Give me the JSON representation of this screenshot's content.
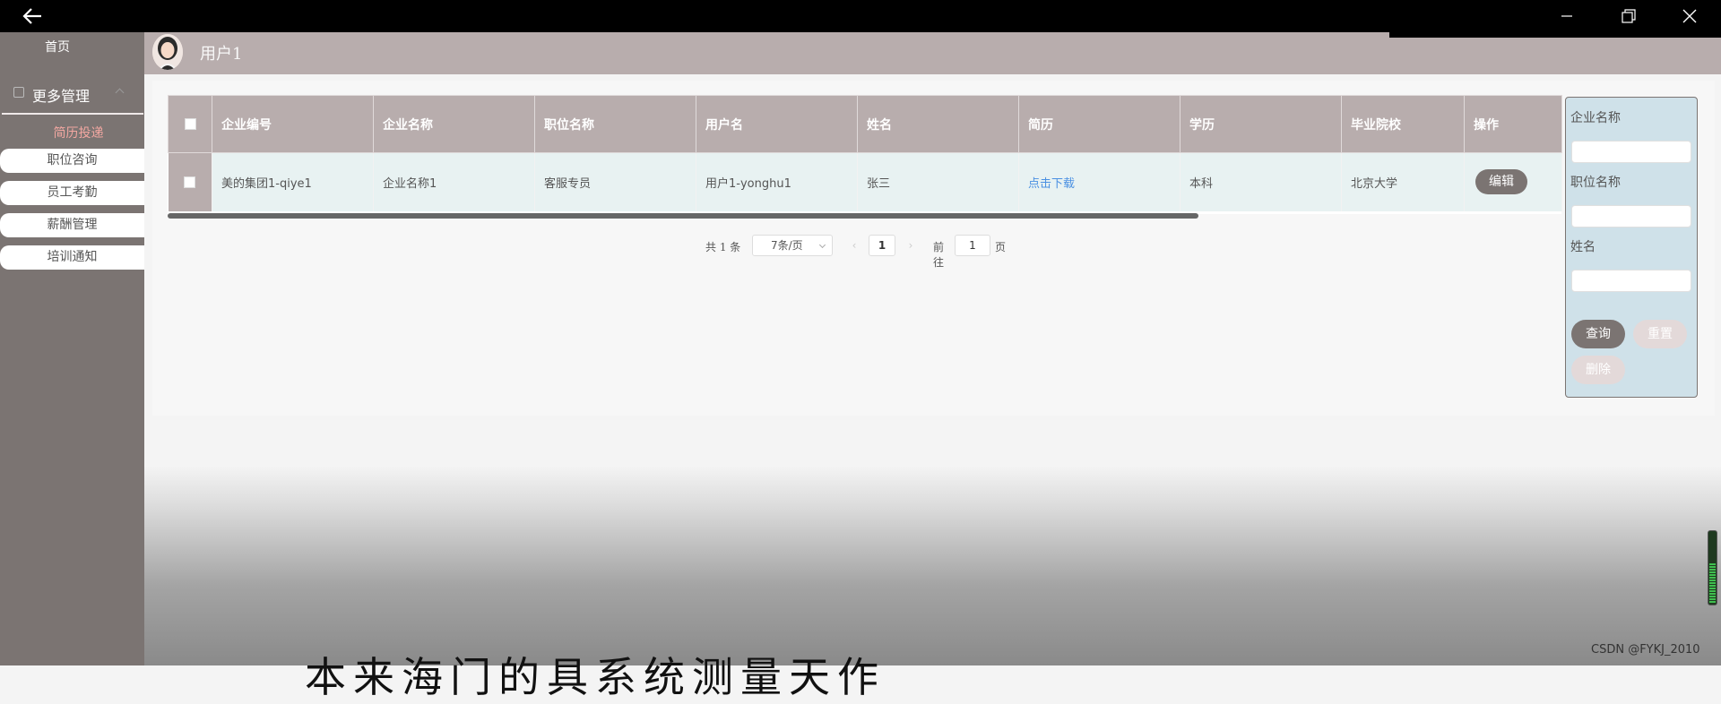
{
  "window": {
    "back_icon": "arrow-left-icon",
    "minimize_icon": "minimize-icon",
    "restore_icon": "restore-icon",
    "close_icon": "close-icon"
  },
  "sidebar": {
    "home": "首页",
    "more_management": "更多管理",
    "active_item": "简历投递",
    "items": [
      {
        "label": "职位咨询"
      },
      {
        "label": "员工考勤"
      },
      {
        "label": "薪酬管理"
      },
      {
        "label": "培训通知"
      }
    ]
  },
  "header": {
    "username": "用户1"
  },
  "table": {
    "columns": [
      "企业编号",
      "企业名称",
      "职位名称",
      "用户名",
      "姓名",
      "简历",
      "学历",
      "毕业院校",
      "操作"
    ],
    "rows": [
      {
        "company_id": "美的集团1-qiye1",
        "company_name": "企业名称1",
        "position": "客服专员",
        "user": "用户1-yonghu1",
        "name": "张三",
        "resume_link": "点击下载",
        "education": "本科",
        "school": "北京大学",
        "action": "编辑"
      }
    ]
  },
  "pager": {
    "total": "共 1 条",
    "page_size": "7条/页",
    "current_page": "1",
    "goto_label": "前往",
    "goto_value": "1",
    "page_unit": "页"
  },
  "search": {
    "company_label": "企业名称",
    "position_label": "职位名称",
    "name_label": "姓名",
    "query": "查询",
    "reset": "重置",
    "delete": "删除"
  },
  "overlay": {
    "caption": "本来海门的具系统测量天作",
    "watermark": "CSDN @FYKJ_2010"
  },
  "colors": {
    "sidebar": "#7b7472",
    "header": "#b8adad",
    "active_text": "#f2a7a1",
    "row_bg": "#e8f2f2",
    "search_panel": "#cfe1e9",
    "link": "#4a90e2"
  }
}
